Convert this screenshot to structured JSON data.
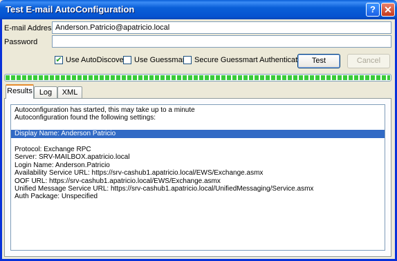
{
  "window": {
    "title": "Test E-mail AutoConfiguration",
    "help_glyph": "?",
    "close_glyph": "✕"
  },
  "form": {
    "email_label": "E-mail Address",
    "email_value": "Anderson.Patricio@apatricio.local",
    "password_label": "Password",
    "password_value": ""
  },
  "options": {
    "use_autodiscover": {
      "label": "Use AutoDiscover",
      "checked": true
    },
    "use_guessmart": {
      "label": "Use Guessmart",
      "checked": false
    },
    "secure_guessmart": {
      "label": "Secure Guessmart Authentication",
      "checked": false
    }
  },
  "buttons": {
    "test": "Test",
    "cancel": "Cancel"
  },
  "progress": {
    "value": 1.0,
    "color": "#3acb3a"
  },
  "tabs": [
    {
      "label": "Results",
      "active": true
    },
    {
      "label": "Log",
      "active": false
    },
    {
      "label": "XML",
      "active": false
    }
  ],
  "results": {
    "lines": [
      "Autoconfiguration has started, this may take up to a minute",
      "Autoconfiguration found the following settings:",
      "",
      "Display Name: Anderson Patricio",
      "",
      "Protocol: Exchange RPC",
      "Server: SRV-MAILBOX.apatricio.local",
      "Login Name: Anderson.Patricio",
      "Availability Service URL: https://srv-cashub1.apatricio.local/EWS/Exchange.asmx",
      "OOF URL: https://srv-cashub1.apatricio.local/EWS/Exchange.asmx",
      "Unified Message Service URL: https://srv-cashub1.apatricio.local/UnifiedMessaging/Service.asmx",
      "Auth Package: Unspecified"
    ],
    "selected_line": "Display Name: Anderson Patricio"
  }
}
